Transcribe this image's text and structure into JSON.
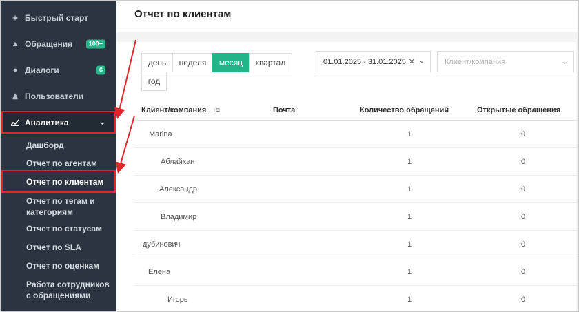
{
  "sidebar": {
    "items": [
      {
        "label": "Быстрый старт",
        "icon": "rocket-icon",
        "badge": ""
      },
      {
        "label": "Обращения",
        "icon": "warning-icon",
        "badge": "100+"
      },
      {
        "label": "Диалоги",
        "icon": "chat-icon",
        "badge": "6"
      },
      {
        "label": "Пользователи",
        "icon": "users-icon",
        "badge": ""
      },
      {
        "label": "Аналитика",
        "icon": "chart-line-icon",
        "badge": ""
      }
    ],
    "subitems": [
      {
        "label": "Дашборд"
      },
      {
        "label": "Отчет по агентам"
      },
      {
        "label": "Отчет по клиентам"
      },
      {
        "label": "Отчет по тегам и категориям"
      },
      {
        "label": "Отчет по статусам"
      },
      {
        "label": "Отчет по SLA"
      },
      {
        "label": "Отчет по оценкам"
      },
      {
        "label": "Работа сотрудников с обращениями"
      }
    ]
  },
  "header": {
    "title": "Отчет по клиентам"
  },
  "period": {
    "buttons": [
      "день",
      "неделя",
      "месяц",
      "квартал",
      "год"
    ],
    "selected": "месяц"
  },
  "filters": {
    "date_range": "01.01.2025 - 31.01.2025",
    "client_placeholder": "Клиент/компания"
  },
  "table": {
    "headers": [
      "Клиент/компания",
      "Почта",
      "Количество обращений",
      "Открытые обращения"
    ],
    "rows": [
      {
        "name": "Marina",
        "email": "",
        "count": "1",
        "open": "0"
      },
      {
        "name": "Аблайхан",
        "email": "",
        "count": "1",
        "open": "0"
      },
      {
        "name": "Александр",
        "email": "",
        "count": "1",
        "open": "0"
      },
      {
        "name": "Владимир",
        "email": "",
        "count": "1",
        "open": "0"
      },
      {
        "name": "дубинович",
        "email": "",
        "count": "1",
        "open": "0"
      },
      {
        "name": "Елена",
        "email": "",
        "count": "1",
        "open": "0"
      },
      {
        "name": "Игорь",
        "email": "",
        "count": "1",
        "open": "0"
      }
    ]
  },
  "colors": {
    "sidebar_bg": "#2b3440",
    "accent": "#23b48a",
    "annotation": "#e0262b"
  }
}
